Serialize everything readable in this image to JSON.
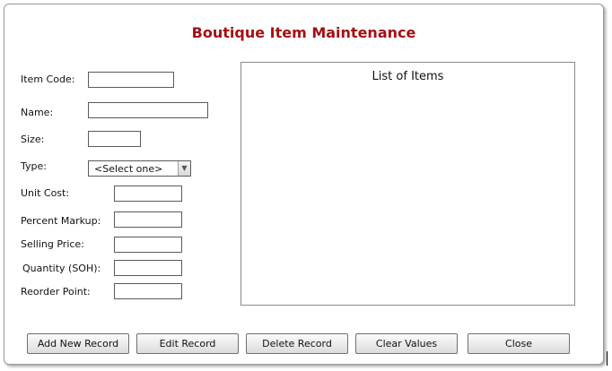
{
  "window": {
    "title": "Boutique Item Maintenance"
  },
  "form": {
    "item_code_label": "Item Code:",
    "name_label": "Name:",
    "size_label": "Size:",
    "type_label": "Type:",
    "type_selected": "<Select one>",
    "unit_cost_label": "Unit Cost:",
    "percent_markup_label": "Percent Markup:",
    "selling_price_label": "Selling Price:",
    "quantity_label": "Quantity (SOH):",
    "reorder_point_label": "Reorder Point:",
    "item_code_value": "",
    "name_value": "",
    "size_value": "",
    "unit_cost_value": "",
    "percent_markup_value": "",
    "selling_price_value": "",
    "quantity_value": "",
    "reorder_point_value": ""
  },
  "list": {
    "caption": "List of Items"
  },
  "buttons": {
    "add": "Add New Record",
    "edit": "Edit Record",
    "delete": "Delete Record",
    "clear": "Clear Values",
    "close": "Close"
  }
}
